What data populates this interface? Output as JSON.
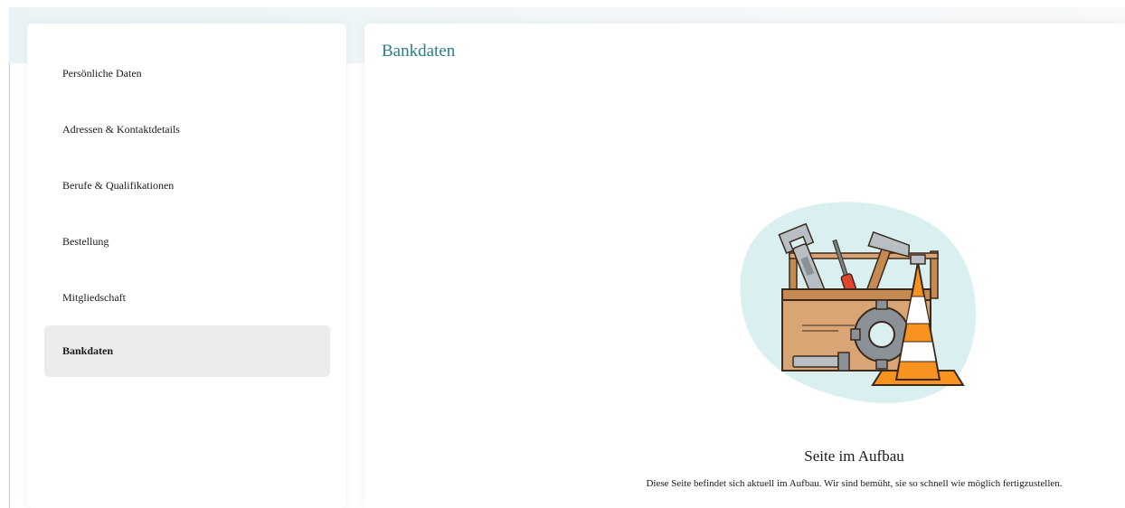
{
  "sidebar": {
    "items": [
      {
        "label": "Persönliche Daten",
        "active": false
      },
      {
        "label": "Adressen & Kontaktdetails",
        "active": false
      },
      {
        "label": "Berufe & Qualifikationen",
        "active": false
      },
      {
        "label": "Bestellung",
        "active": false
      },
      {
        "label": "Mitgliedschaft",
        "active": false
      },
      {
        "label": "Bankdaten",
        "active": true
      }
    ]
  },
  "main": {
    "title": "Bankdaten",
    "illustration_icon": "toolbox-construction-icon",
    "construction_heading": "Seite im Aufbau",
    "construction_text": "Diese Seite befindet sich aktuell im Aufbau. Wir sind bemüht, sie so schnell wie möglich fertigzustellen."
  },
  "colors": {
    "title": "#2a7e86",
    "active_item_bg": "#ececec",
    "blob": "#d9eff0",
    "cone_orange": "#f7931e",
    "box_brown": "#d9a574"
  }
}
